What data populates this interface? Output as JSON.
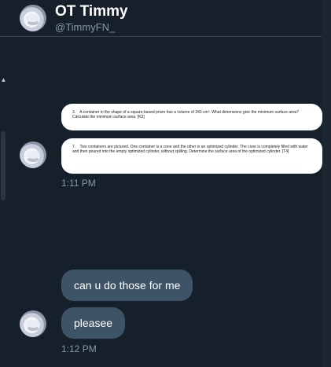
{
  "header": {
    "name": "OT Timmy",
    "handle": "@TimmyFN_"
  },
  "messages": {
    "image_card_1": {
      "number": "3.",
      "text": "A container in the shape of a square-based prism has a volume of 343 cm³. What dimensions give the minimum surface area? Calculate the minimum surface area. [K3]"
    },
    "image_card_2": {
      "number": "7.",
      "text": "Two containers are pictured. One container is a cone and the other is an optimized cylinder. The cone is completely filled with water and then poured into the empty optimized cylinder, without spilling. Determine the surface area of the optimized cylinder. [T4]"
    },
    "time_1": "1:11 PM",
    "bubble_1": "can u do those for me",
    "bubble_2": "pleasee",
    "time_2": "1:12 PM"
  }
}
